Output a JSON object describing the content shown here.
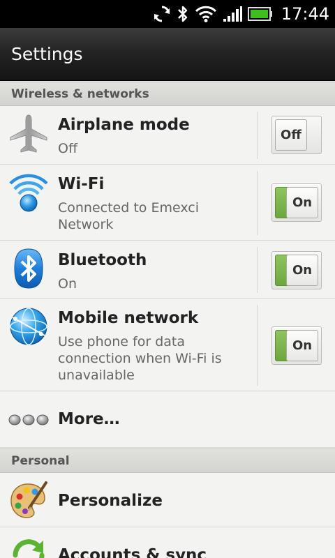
{
  "status_bar": {
    "time": "17:44",
    "icons": [
      "sync-icon",
      "bluetooth-icon",
      "wifi-signal-icon",
      "cell-signal-icon",
      "battery-icon"
    ],
    "battery_color": "#3fbf1f"
  },
  "header": {
    "title": "Settings"
  },
  "sections": [
    {
      "label": "Wireless & networks"
    },
    {
      "label": "Personal"
    }
  ],
  "wireless": {
    "airplane": {
      "title": "Airplane mode",
      "subtitle": "Off",
      "toggle": "Off",
      "icon": "airplane-icon"
    },
    "wifi": {
      "title": "Wi-Fi",
      "subtitle": "Connected to Emexci Network",
      "toggle": "On",
      "icon": "wifi-icon"
    },
    "bluetooth": {
      "title": "Bluetooth",
      "subtitle": "On",
      "toggle": "On",
      "icon": "bluetooth-icon"
    },
    "mobile": {
      "title": "Mobile network",
      "subtitle": "Use phone for data connection when Wi-Fi is unavailable",
      "toggle": "On",
      "icon": "globe-icon"
    },
    "more": {
      "title": "More…",
      "icon": "more-dots-icon"
    }
  },
  "personal": {
    "personalize": {
      "title": "Personalize",
      "icon": "palette-icon"
    },
    "accounts": {
      "title": "Accounts & sync",
      "icon": "sync-arrows-icon"
    }
  },
  "colors": {
    "toggle_on_green": "#7cb34a",
    "title_bar": "#1f1f1f",
    "list_background": "#f3f3f1"
  }
}
